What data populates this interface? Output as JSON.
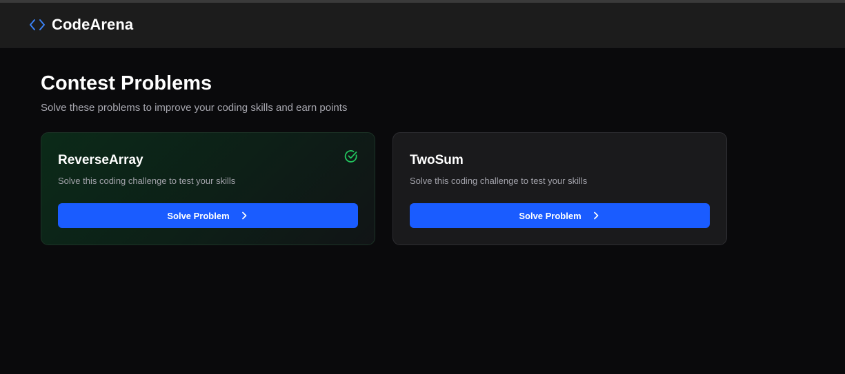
{
  "app": {
    "brand_name": "CodeArena",
    "brand_icon": "code-brackets-icon",
    "accent_color": "#1a5cff",
    "success_color": "#22c55e"
  },
  "page": {
    "title": "Contest Problems",
    "subtitle": "Solve these problems to improve your coding skills and earn points"
  },
  "problems": [
    {
      "title": "ReverseArray",
      "description": "Solve this coding challenge to test your skills",
      "button_label": "Solve Problem",
      "solved": true,
      "status_icon": "check-circle-icon"
    },
    {
      "title": "TwoSum",
      "description": "Solve this coding challenge to test your skills",
      "button_label": "Solve Problem",
      "solved": false
    }
  ]
}
